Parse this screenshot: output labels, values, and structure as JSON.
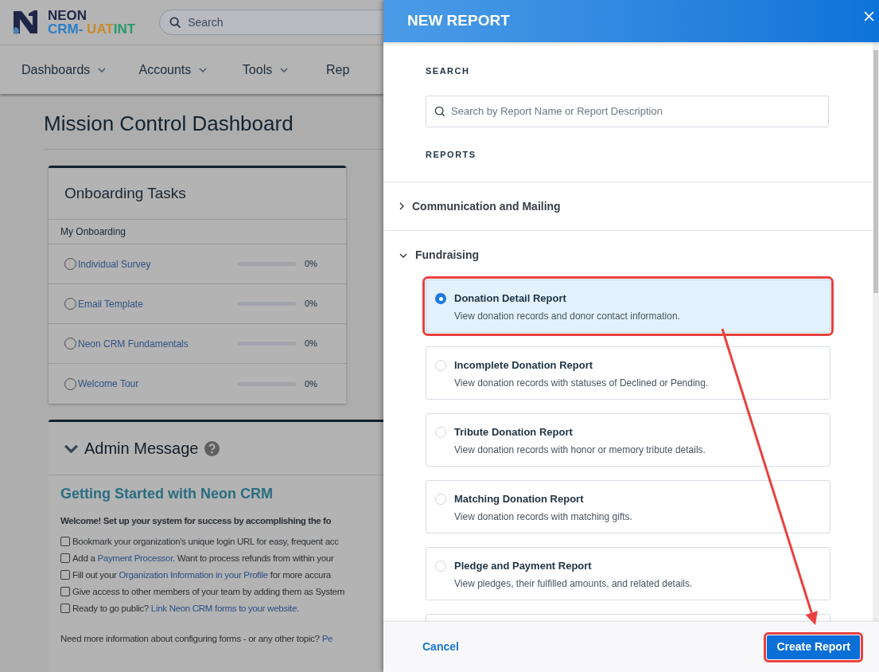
{
  "app": {
    "brand": "NEON",
    "brand_suffix": [
      {
        "text": "CRM-",
        "color": "#2b7fc7"
      },
      {
        "text": " UAT",
        "color": "#c98b2c"
      },
      {
        "text": "INT",
        "color": "#279a6b"
      }
    ],
    "search_placeholder": "Search"
  },
  "nav": [
    "Dashboards",
    "Accounts",
    "Tools",
    "Rep"
  ],
  "page_title": "Mission Control Dashboard",
  "onboarding": {
    "title": "Onboarding Tasks",
    "subtitle": "My Onboarding",
    "tasks": [
      {
        "label": "Individual Survey",
        "done": false,
        "level": 0,
        "reading": "0%"
      },
      {
        "label": "Email Template",
        "done": false,
        "level": 0,
        "reading": "0%"
      },
      {
        "label": "Neon CRM Fundamentals",
        "done": false,
        "level": 0,
        "reading": "0%"
      },
      {
        "label": "Welcome Tour",
        "done": false,
        "level": 0,
        "reading": "0%"
      }
    ]
  },
  "admin_message": {
    "title": "Admin Message",
    "expanded": true,
    "heading": "Getting Started with Neon CRM",
    "intro": "Welcome! Set up your system for success by accomplishing the fo",
    "checklist": [
      {
        "checked": false,
        "parts": [
          {
            "text": "Bookmark your organization's unique login URL for easy, frequent acc",
            "link": false
          }
        ]
      },
      {
        "checked": false,
        "parts": [
          {
            "text": "Add a ",
            "link": false
          },
          {
            "text": "Payment Processor.",
            "link": true
          },
          {
            "text": " Want to process refunds from within your",
            "link": false
          }
        ]
      },
      {
        "checked": false,
        "parts": [
          {
            "text": "Fill out your ",
            "link": false
          },
          {
            "text": "Organization Information in your Profile",
            "link": true
          },
          {
            "text": " for more accura",
            "link": false
          }
        ]
      },
      {
        "checked": false,
        "parts": [
          {
            "text": "Give access to other members of your team by adding them as System",
            "link": false
          }
        ]
      },
      {
        "checked": false,
        "parts": [
          {
            "text": "Ready to go public? ",
            "link": false
          },
          {
            "text": "Link Neon CRM forms to your website.",
            "link": true
          }
        ]
      }
    ],
    "footer_parts": [
      {
        "text": "Need more information about configuring forms - or any other topic? ",
        "link": false
      },
      {
        "text": "Pe",
        "link": true
      }
    ]
  },
  "panel": {
    "title": "NEW REPORT",
    "search_label": "SEARCH",
    "search_placeholder": "Search by Report Name or Report Description",
    "reports_label": "REPORTS",
    "categories": [
      {
        "name": "Communication and Mailing",
        "expanded": false
      },
      {
        "name": "Fundraising",
        "expanded": true,
        "reports": [
          {
            "name": "Donation Detail Report",
            "description": "View donation records and donor contact information.",
            "selected": true,
            "highlighted": true
          },
          {
            "name": "Incomplete Donation Report",
            "description": "View donation records with statuses of Declined or Pending.",
            "selected": false,
            "highlighted": false
          },
          {
            "name": "Tribute Donation Report",
            "description": "View donation records with honor or memory tribute details.",
            "selected": false,
            "highlighted": false
          },
          {
            "name": "Matching Donation Report",
            "description": "View donation records with matching gifts.",
            "selected": false,
            "highlighted": false
          },
          {
            "name": "Pledge and Payment Report",
            "description": "View pledges, their fulfilled amounts, and related details.",
            "selected": false,
            "highlighted": false
          }
        ]
      }
    ],
    "cancel": "Cancel",
    "create": {
      "label": "Create Report",
      "highlighted": true
    },
    "callout_arrow": true
  }
}
